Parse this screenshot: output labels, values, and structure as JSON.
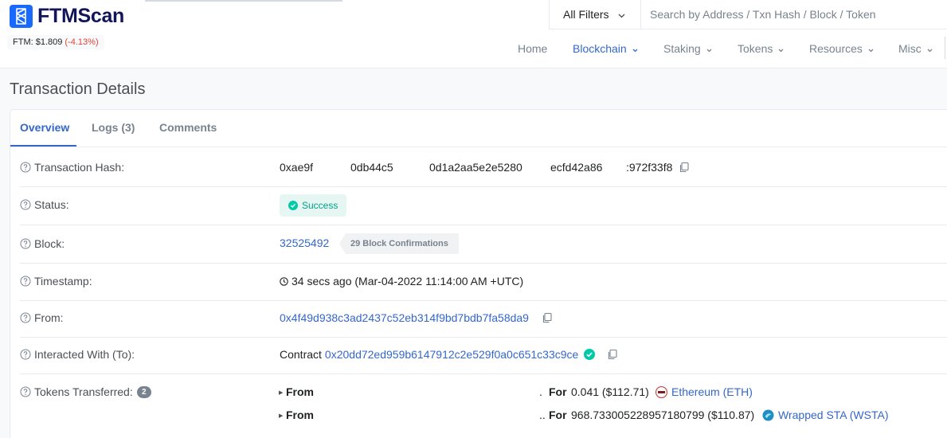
{
  "header": {
    "brand": "FTMScan",
    "price_label": "FTM: $1.809",
    "price_change": "(-4.13%)",
    "filter_label": "All Filters",
    "search_placeholder": "Search by Address / Txn Hash / Block / Token",
    "nav": [
      {
        "label": "Home",
        "active": false,
        "dropdown": false
      },
      {
        "label": "Blockchain",
        "active": true,
        "dropdown": true
      },
      {
        "label": "Staking",
        "active": false,
        "dropdown": true
      },
      {
        "label": "Tokens",
        "active": false,
        "dropdown": true
      },
      {
        "label": "Resources",
        "active": false,
        "dropdown": true
      },
      {
        "label": "Misc",
        "active": false,
        "dropdown": true
      }
    ]
  },
  "page": {
    "title": "Transaction Details",
    "tabs": [
      "Overview",
      "Logs (3)",
      "Comments"
    ],
    "active_tab": "Overview"
  },
  "details": {
    "tx_hash": {
      "label": "Transaction Hash:",
      "parts": [
        "0xae9f",
        "0db44c5",
        "0d1a2aa5e2e5280",
        "ecfd42a86",
        ":972f33f8"
      ]
    },
    "status": {
      "label": "Status:",
      "value": "Success"
    },
    "block": {
      "label": "Block:",
      "number": "32525492",
      "confirmations": "29 Block Confirmations"
    },
    "timestamp": {
      "label": "Timestamp:",
      "value": "34 secs ago (Mar-04-2022 11:14:00 AM +UTC)"
    },
    "from": {
      "label": "From:",
      "address": "0x4f49d938c3ad2437c52eb314f9bd7bdb7fa58da9"
    },
    "interacted": {
      "label": "Interacted With (To):",
      "prefix": "Contract",
      "address": "0x20dd72ed959b6147912c2e529f0a0c651c33c9ce"
    },
    "tokens": {
      "label": "Tokens Transferred:",
      "count": "2",
      "rows": [
        {
          "from": "From",
          "dot": ".",
          "for": "For",
          "amount": "0.041 ($112.71)",
          "token": "Ethereum (ETH)"
        },
        {
          "from": "From",
          "dot": "..",
          "for": "For",
          "amount": "968.733005228957180799 ($110.87)",
          "token": "Wrapped STA (WSTA)"
        }
      ]
    }
  },
  "colors": {
    "brand": "#1969ff",
    "link": "#3467c9",
    "success": "#00c9a7",
    "negative": "#de4437"
  }
}
